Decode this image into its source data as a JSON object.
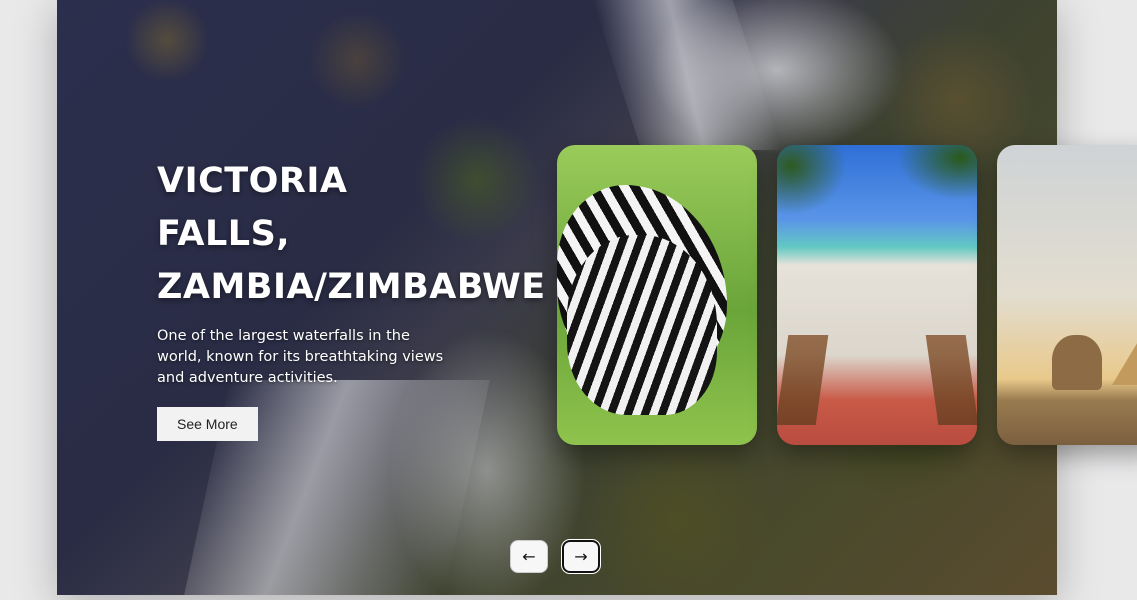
{
  "slide": {
    "title": "VICTORIA\nFALLS,\nZAMBIA/ZIMBABWE",
    "description": "One of the largest waterfalls in the world, known for its breathtaking views and adventure activities.",
    "button_label": "See More"
  },
  "cards": [
    {
      "name": "zebras",
      "icon": "zebra-image"
    },
    {
      "name": "beach",
      "icon": "beach-image"
    },
    {
      "name": "pyramids",
      "icon": "pyramid-image"
    }
  ],
  "nav": {
    "prev_icon": "arrow-left-icon",
    "next_icon": "arrow-right-icon",
    "prev_glyph": "←",
    "next_glyph": "→"
  },
  "colors": {
    "button_bg": "#f2f2f2",
    "text": "#ffffff"
  }
}
